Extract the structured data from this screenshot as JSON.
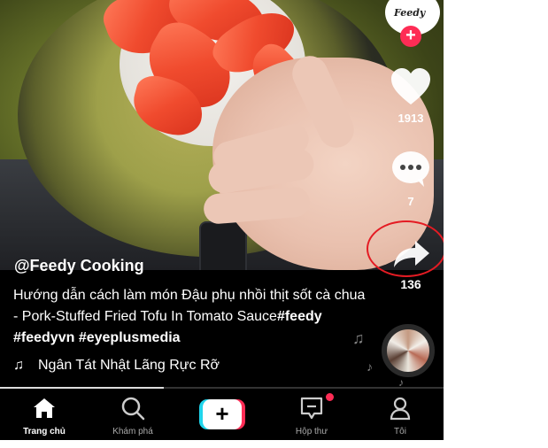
{
  "video": {
    "author": "@Feedy Cooking",
    "caption_text": "Hướng dẫn cách làm món Đậu phụ nhồi thịt sốt cà chua - Pork-Stuffed Fried Tofu In Tomato Sauce",
    "hashtags": [
      "#feedy",
      "#feedyvn",
      "#eyeplusmedia"
    ],
    "music_text": "Ngân   Tát Nhật Lãng Rực Rỡ"
  },
  "sidebar": {
    "profile_logo_text": "Feedy",
    "like_count": "1913",
    "comment_count": "7",
    "share_count": "136"
  },
  "nav": {
    "home_label": "Trang chủ",
    "discover_label": "Khám phá",
    "inbox_label": "Hộp thư",
    "profile_label": "Tôi"
  },
  "colors": {
    "accent_pink": "#fe2c55",
    "accent_cyan": "#20d5ec",
    "annotation_red": "#e41b23"
  },
  "icons": [
    "heart-icon",
    "comment-icon",
    "share-icon",
    "music-note-icon",
    "home-icon",
    "search-icon",
    "add-icon",
    "inbox-icon",
    "profile-icon"
  ],
  "progress_fraction": 0.37
}
